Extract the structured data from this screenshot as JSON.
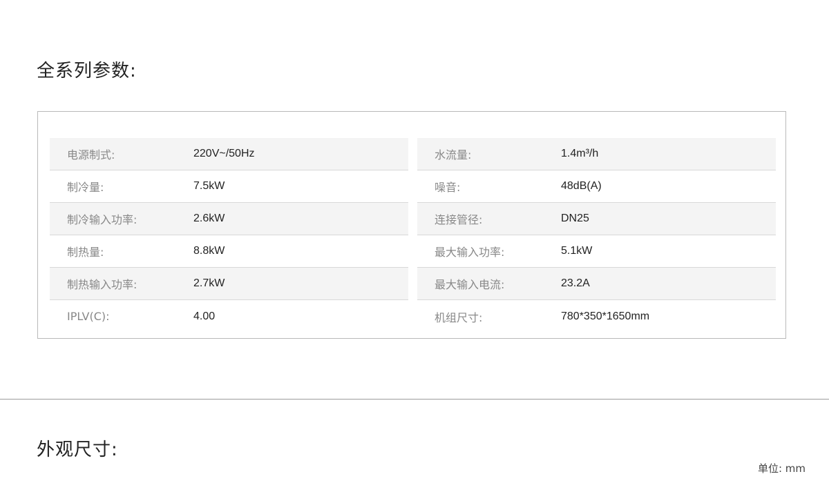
{
  "section_params_title": "全系列参数:",
  "section_dims_title": "外观尺寸:",
  "unit_note": "单位: mm",
  "specs_left": [
    {
      "label": "电源制式:",
      "value": "220V~/50Hz"
    },
    {
      "label": "制冷量:",
      "value": "7.5kW"
    },
    {
      "label": "制冷输入功率:",
      "value": "2.6kW"
    },
    {
      "label": "制热量:",
      "value": "8.8kW"
    },
    {
      "label": "制热输入功率:",
      "value": "2.7kW"
    },
    {
      "label": "IPLV(C):",
      "value": "4.00"
    }
  ],
  "specs_right": [
    {
      "label": "水流量:",
      "value": "1.4m³/h"
    },
    {
      "label": "噪音:",
      "value": "48dB(A)"
    },
    {
      "label": "连接管径:",
      "value": "DN25"
    },
    {
      "label": "最大输入功率:",
      "value": "5.1kW"
    },
    {
      "label": "最大输入电流:",
      "value": "23.2A"
    },
    {
      "label": "机组尺寸:",
      "value": "780*350*1650mm"
    }
  ]
}
